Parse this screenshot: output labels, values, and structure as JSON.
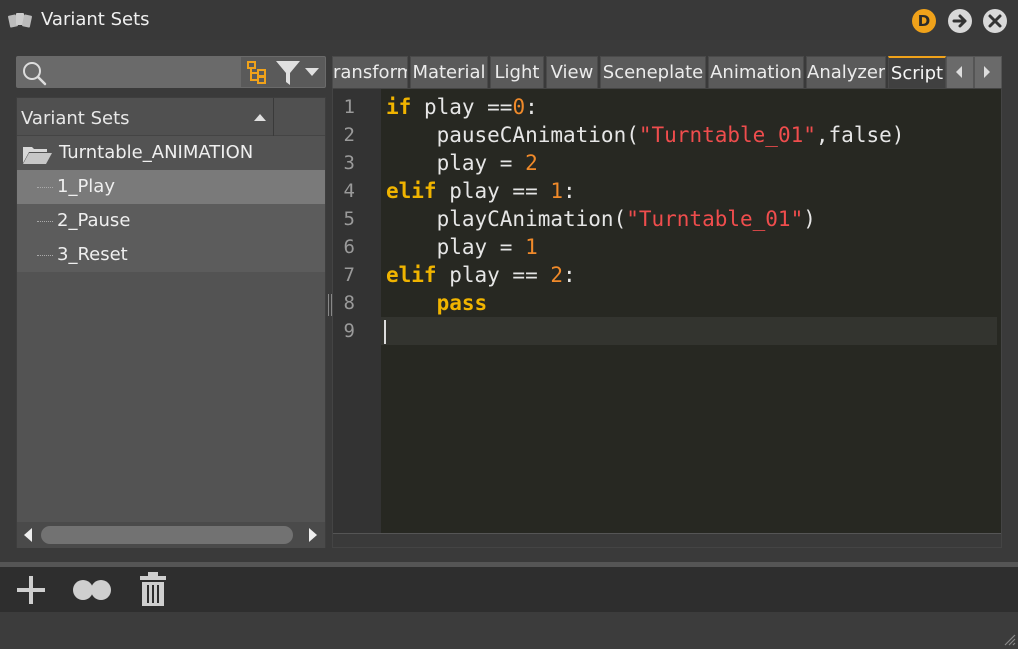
{
  "window": {
    "title": "Variant Sets",
    "d_badge": "D"
  },
  "search": {
    "placeholder": "",
    "value": ""
  },
  "tree": {
    "header": "Variant Sets",
    "root": "Turntable_ANIMATION",
    "items": [
      "1_Play",
      "2_Pause",
      "3_Reset"
    ],
    "selected_index": 0
  },
  "tabs": [
    {
      "label": "ransform",
      "active": false
    },
    {
      "label": "Material",
      "active": false
    },
    {
      "label": "Light",
      "active": false
    },
    {
      "label": "View",
      "active": false
    },
    {
      "label": "Sceneplate",
      "active": false
    },
    {
      "label": "Animation",
      "active": false
    },
    {
      "label": "Analyzer",
      "active": false
    },
    {
      "label": "Script",
      "active": true
    }
  ],
  "editor": {
    "line_numbers": [
      "1",
      "2",
      "3",
      "4",
      "5",
      "6",
      "7",
      "8",
      "9"
    ],
    "lines": [
      [
        {
          "t": "if",
          "c": "kw"
        },
        {
          "t": " play ==",
          "c": ""
        },
        {
          "t": "0",
          "c": "num"
        },
        {
          "t": ":",
          "c": ""
        }
      ],
      [
        {
          "t": "    pauseCAnimation(",
          "c": ""
        },
        {
          "t": "\"Turntable_01\"",
          "c": "str"
        },
        {
          "t": ",false)",
          "c": ""
        }
      ],
      [
        {
          "t": "    play = ",
          "c": ""
        },
        {
          "t": "2",
          "c": "num"
        }
      ],
      [
        {
          "t": "elif",
          "c": "kw"
        },
        {
          "t": " play == ",
          "c": ""
        },
        {
          "t": "1",
          "c": "num"
        },
        {
          "t": ":",
          "c": ""
        }
      ],
      [
        {
          "t": "    playCAnimation(",
          "c": ""
        },
        {
          "t": "\"Turntable_01\"",
          "c": "str"
        },
        {
          "t": ")",
          "c": ""
        }
      ],
      [
        {
          "t": "    play = ",
          "c": ""
        },
        {
          "t": "1",
          "c": "num"
        }
      ],
      [
        {
          "t": "elif",
          "c": "kw"
        },
        {
          "t": " play == ",
          "c": ""
        },
        {
          "t": "2",
          "c": "num"
        },
        {
          "t": ":",
          "c": ""
        }
      ],
      [
        {
          "t": "    ",
          "c": ""
        },
        {
          "t": "pass",
          "c": "kw"
        }
      ],
      []
    ]
  },
  "colors": {
    "accent": "#f0a21a",
    "keyword": "#f0b400",
    "number": "#f08a2a",
    "string": "#ef4d4d"
  },
  "icons": {
    "app": "cards-icon",
    "badge": "d-badge-icon",
    "arrow": "arrow-right-icon",
    "close": "close-icon",
    "search": "search-icon",
    "tree": "tree-view-icon",
    "filter": "filter-icon",
    "folder": "folder-open-icon",
    "add": "plus-icon",
    "duplicate": "duplicate-icon",
    "delete": "trash-icon"
  }
}
